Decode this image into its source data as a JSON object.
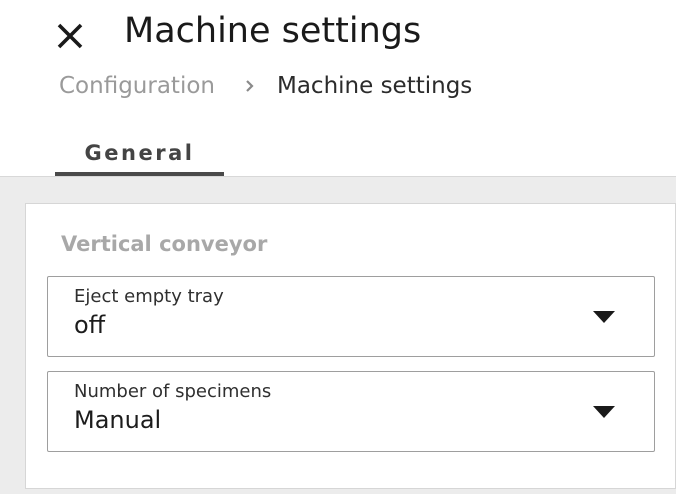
{
  "header": {
    "title": "Machine settings",
    "close_icon": "close-icon"
  },
  "breadcrumb": {
    "items": [
      {
        "label": "Configuration"
      },
      {
        "label": "Machine settings"
      }
    ],
    "separator": "›"
  },
  "tabs": [
    {
      "label": "General",
      "active": true
    }
  ],
  "section": {
    "title": "Vertical conveyor",
    "fields": [
      {
        "label": "Eject empty tray",
        "value": "off",
        "icon": "caret-down-icon"
      },
      {
        "label": "Number of specimens",
        "value": "Manual",
        "icon": "caret-down-icon"
      }
    ]
  },
  "colors": {
    "background": "#ececec",
    "card": "#ffffff",
    "tab_underline": "#4a4a4a",
    "muted_text": "#a8a8a8"
  }
}
